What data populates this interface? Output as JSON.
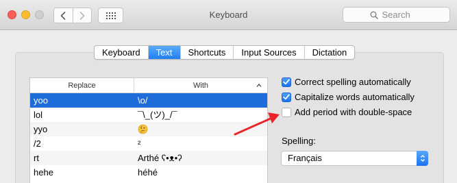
{
  "window": {
    "title": "Keyboard"
  },
  "search": {
    "placeholder": "Search"
  },
  "tabs": [
    {
      "label": "Keyboard"
    },
    {
      "label": "Text",
      "selected": true
    },
    {
      "label": "Shortcuts"
    },
    {
      "label": "Input Sources"
    },
    {
      "label": "Dictation"
    }
  ],
  "table": {
    "headers": {
      "replace": "Replace",
      "with": "With"
    },
    "rows": [
      {
        "replace": "yoo",
        "with": "\\o/",
        "selected": true
      },
      {
        "replace": "lol",
        "with": "¯\\_(ツ)_/¯"
      },
      {
        "replace": "yyo",
        "with": "",
        "with_icon": "thinking-face-emoji-icon"
      },
      {
        "replace": "/2",
        "with": "²"
      },
      {
        "replace": "rt",
        "with": "Arthé ʕ•ᴥ•ʔ"
      },
      {
        "replace": "hehe",
        "with": "héhé"
      }
    ]
  },
  "options": {
    "correct_spelling": {
      "label": "Correct spelling automatically",
      "checked": true
    },
    "capitalize_words": {
      "label": "Capitalize words automatically",
      "checked": true
    },
    "add_period": {
      "label": "Add period with double-space",
      "checked": false
    }
  },
  "spelling": {
    "label": "Spelling:",
    "value": "Français"
  },
  "icons": {
    "back": "chevron-left-icon",
    "forward": "chevron-right-icon",
    "grid": "grid-icon",
    "search": "search-icon",
    "sort": "chevron-up-icon",
    "popup": "popup-arrows-icon",
    "annotation": "red-arrow-icon"
  },
  "colors": {
    "accent": "#1e6cd9",
    "close": "#fc5f57",
    "minimize": "#fdbc2e",
    "zoom_inactive": "#cfcfcf",
    "annotation": "#e8262a"
  }
}
